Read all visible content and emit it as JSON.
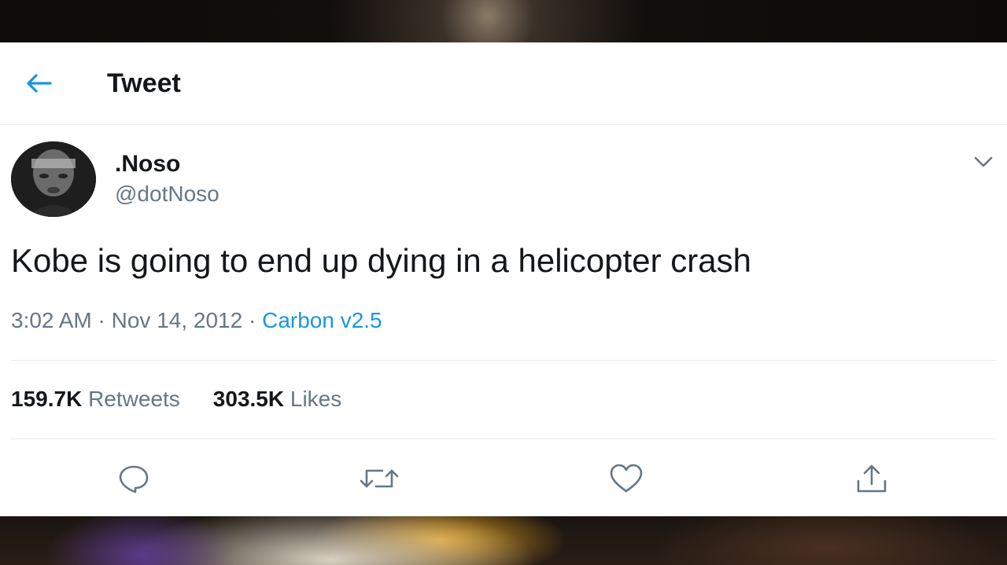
{
  "header": {
    "title": "Tweet"
  },
  "tweet": {
    "author": {
      "display_name": ".Noso",
      "handle": "@dotNoso"
    },
    "text": "Kobe is going to end up dying in a helicopter crash",
    "time": "3:02 AM",
    "date": "Nov 14, 2012",
    "source": "Carbon v2.5",
    "separator": " · ",
    "retweets_count": "159.7K",
    "retweets_label": " Retweets",
    "likes_count": "303.5K",
    "likes_label": " Likes"
  },
  "icons": {
    "back": "back-arrow-icon",
    "caret": "chevron-down-icon",
    "reply": "reply-icon",
    "retweet": "retweet-icon",
    "like": "heart-icon",
    "share": "share-icon"
  },
  "colors": {
    "accent": "#1b95e0",
    "text": "#14171a",
    "secondary": "#657786"
  }
}
